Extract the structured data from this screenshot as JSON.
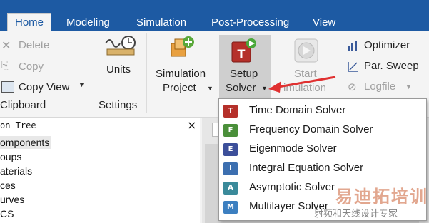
{
  "menubar": {
    "tabs": [
      "Home",
      "Modeling",
      "Simulation",
      "Post-Processing",
      "View"
    ]
  },
  "ribbon": {
    "clipboard": {
      "delete": "Delete",
      "copy": "Copy",
      "copy_view": "Copy View",
      "group_label": "Clipboard"
    },
    "settings": {
      "units": "Units",
      "group_label": "Settings"
    },
    "simulation_project": {
      "line1": "Simulation",
      "line2": "Project"
    },
    "setup_solver": {
      "line1": "Setup",
      "line2": "Solver"
    },
    "start_simulation": {
      "line1": "Start",
      "line2": "imulation"
    },
    "optimizer": "Optimizer",
    "par_sweep": "Par. Sweep",
    "logfile": "Logfile"
  },
  "tree": {
    "title": "on Tree",
    "close": "×",
    "items": [
      "omponents",
      "oups",
      "aterials",
      "ces",
      "urves",
      "CS"
    ]
  },
  "dropdown": {
    "items": [
      {
        "label": "Time Domain Solver",
        "letter": "T",
        "color": "#b5302a"
      },
      {
        "label": "Frequency Domain Solver",
        "letter": "F",
        "color": "#4a8f3a"
      },
      {
        "label": "Eigenmode Solver",
        "letter": "E",
        "color": "#3c4f9a"
      },
      {
        "label": "Integral Equation Solver",
        "letter": "I",
        "color": "#3c6fb0"
      },
      {
        "label": "Asymptotic Solver",
        "letter": "A",
        "color": "#3a8a9a"
      },
      {
        "label": "Multilayer Solver",
        "letter": "M",
        "color": "#3c7fc0"
      }
    ]
  },
  "watermark": {
    "line1": "易迪拓培训",
    "line2": "射频和天线设计专家"
  },
  "colors": {
    "menubar": "#1d5aa3",
    "arrow": "#e03030",
    "setup_highlight": "#c8c8c8"
  }
}
